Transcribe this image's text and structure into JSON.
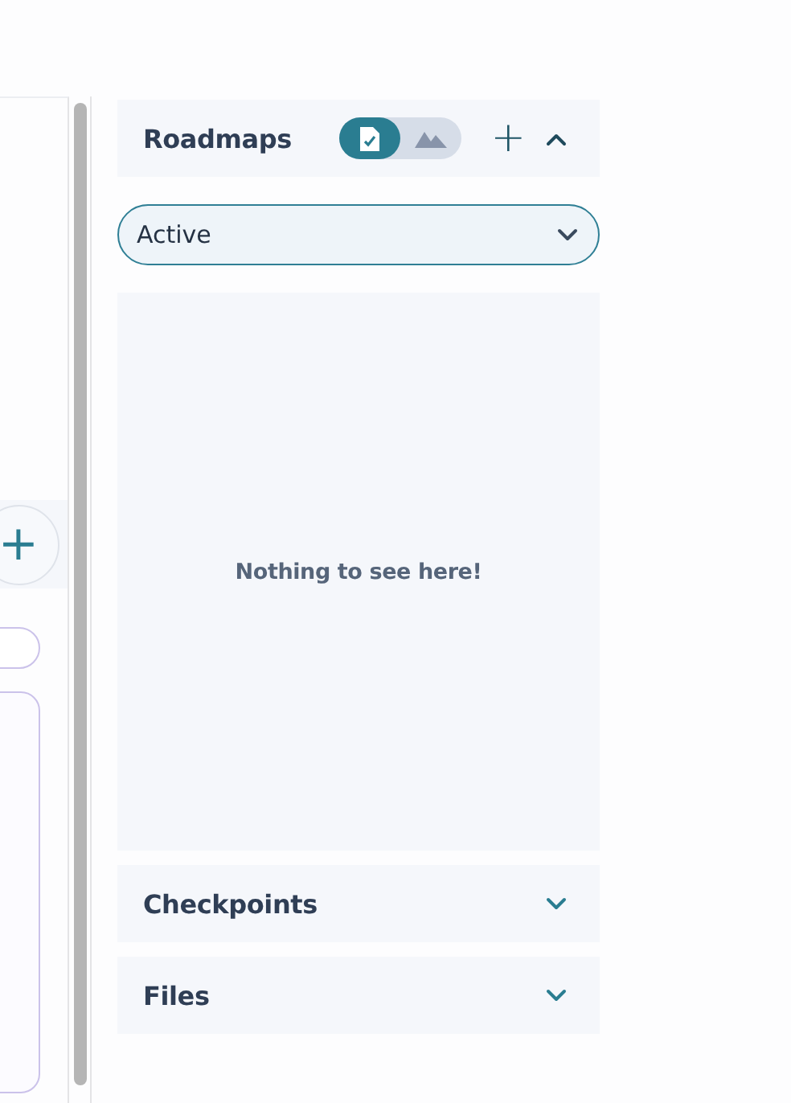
{
  "left_panel": {
    "add_button": {
      "label": "+"
    }
  },
  "sections": [
    {
      "title": "Roadmaps",
      "expanded": true,
      "view_toggle": [
        {
          "selected": true
        },
        {
          "selected": false
        }
      ],
      "add": "+",
      "filter": {
        "value": "Active"
      },
      "empty_message": "Nothing to see here!"
    },
    {
      "title": "Checkpoints",
      "expanded": false
    },
    {
      "title": "Files",
      "expanded": false
    }
  ]
}
